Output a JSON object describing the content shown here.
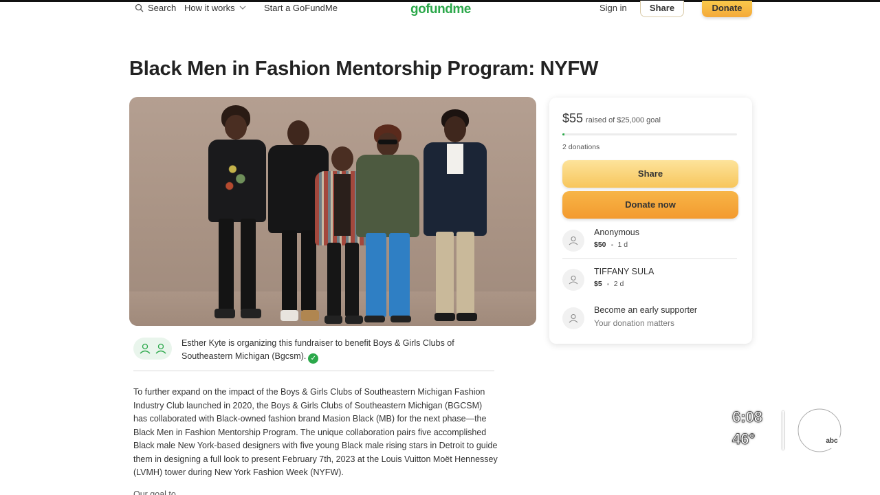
{
  "nav": {
    "search_label": "Search",
    "how_it_works_label": "How it works",
    "start_label": "Start a GoFundMe",
    "logo_text": "gofundme",
    "sign_in_label": "Sign in",
    "share_label": "Share",
    "donate_label": "Donate"
  },
  "campaign": {
    "title": "Black Men in Fashion Mentorship Program: NYFW",
    "image_alt": "Five young men posing together in front of a tan backdrop",
    "organizer_text": "Esther Kyte is organizing this fundraiser to benefit Boys & Girls Clubs of Southeastern Michigan (Bgcsm).",
    "story": "To further expand on the impact of the Boys & Girls Clubs of Southeastern Michigan Fashion Industry Club launched in 2020, the Boys & Girls Clubs of Southeastern Michigan (BGCSM) has collaborated with Black-owned fashion brand Masion Black (MB) for the next phase—the Black Men in Fashion Mentorship Program. The unique collaboration pairs five accomplished Black male New York-based designers with five young Black male rising stars in Detroit to guide them in designing a full look to present February 7th, 2023 at the Louis Vuitton Moët Hennessey (LVMH) tower during New York Fashion Week (NYFW).",
    "story_next": "Our goal to..."
  },
  "donation_card": {
    "raised_amount": "$55",
    "goal_text": "raised of $25,000 goal",
    "progress_fraction": 0.0022,
    "donations_count": "2 donations",
    "share_label": "Share",
    "donate_now_label": "Donate now",
    "donors": [
      {
        "name": "Anonymous",
        "amount": "$50",
        "time": "1 d"
      },
      {
        "name": "TIFFANY SULA",
        "amount": "$5",
        "time": "2 d"
      }
    ],
    "early_supporter": {
      "title": "Become an early supporter",
      "subtitle": "Your donation matters"
    }
  },
  "broadcast_overlay": {
    "time": "6:08",
    "temperature": "46°",
    "station_logo": "7abc"
  },
  "colors": {
    "brand_green": "#2ba84a",
    "donate_orange": "#f39a2f",
    "share_yellow": "#f7c65c"
  },
  "icons": {
    "search": "search-icon",
    "chevron": "chevron-down-icon",
    "verified": "verified-check-icon",
    "donor": "donor-avatar-icon"
  }
}
